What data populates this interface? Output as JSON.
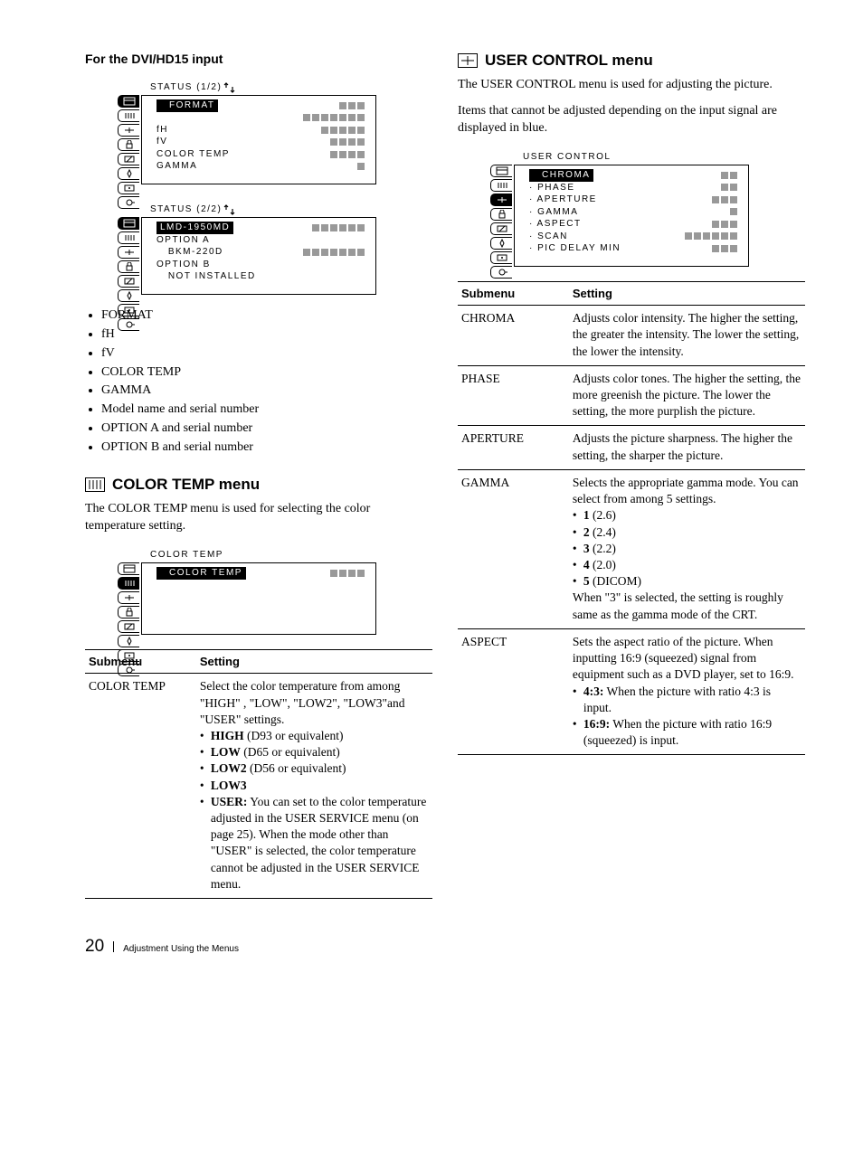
{
  "left": {
    "heading_dvi": "For the DVI/HD15 input",
    "status12_title": "STATUS  (1/2)",
    "status12": {
      "rows": [
        {
          "label": "FORMAT",
          "hilite": true,
          "lead": true,
          "ticks": 3,
          "shifted": false
        },
        {
          "label": "",
          "ticks": 7,
          "shifted": false
        },
        {
          "label": "fH",
          "ticks": 5,
          "shifted": false
        },
        {
          "label": "fV",
          "ticks": 4,
          "shifted": false
        },
        {
          "label": "COLOR TEMP",
          "ticks": 4,
          "shifted": false
        },
        {
          "label": "GAMMA",
          "ticks": 1,
          "shifted": false
        }
      ],
      "selected_tab": 0
    },
    "status22_title": "STATUS  (2/2)",
    "status22": {
      "rows": [
        {
          "label": "LMD-1950MD",
          "hilite": true,
          "ticks": 6,
          "shifted": false
        },
        {
          "label": "OPTION A",
          "ticks": 0,
          "shifted": false
        },
        {
          "label": " BKM-220D",
          "ticks": 7,
          "shifted": true
        },
        {
          "label": "OPTION B",
          "ticks": 0,
          "shifted": false
        },
        {
          "label": " NOT INSTALLED",
          "ticks": 0,
          "shifted": true
        }
      ],
      "selected_tab": 0
    },
    "bullets": [
      "FORMAT",
      "fH",
      "fV",
      "COLOR TEMP",
      "GAMMA",
      "Model name and serial number",
      "OPTION A and serial number",
      "OPTION B and serial number"
    ],
    "color_temp_head": "COLOR TEMP menu",
    "color_temp_intro": "The COLOR TEMP menu is used for selecting the color temperature setting.",
    "colortemp_osd_title": "COLOR TEMP",
    "colortemp_osd": {
      "rows": [
        {
          "label": "COLOR TEMP",
          "hilite": true,
          "lead": true,
          "ticks": 4
        }
      ],
      "selected_tab": 1
    },
    "table_head_sub": "Submenu",
    "table_head_set": "Setting",
    "ct_row_name": "COLOR TEMP",
    "ct_row_intro": "Select the color temperature from among \"HIGH\" , \"LOW\", \"LOW2\", \"LOW3\"and \"USER\" settings.",
    "ct_bul_high_b": "HIGH",
    "ct_bul_high_t": " (D93 or equivalent)",
    "ct_bul_low_b": "LOW",
    "ct_bul_low_t": " (D65 or equivalent)",
    "ct_bul_low2_b": "LOW2",
    "ct_bul_low2_t": " (D56 or equivalent)",
    "ct_bul_low3_b": "LOW3",
    "ct_bul_user_b": "USER:",
    "ct_bul_user_t": " You can set to the color temperature adjusted in the USER SERVICE menu (on page 25).  When the mode other than \"USER\" is selected, the color temperature cannot be adjusted in the USER SERVICE menu."
  },
  "right": {
    "user_control_head": "USER CONTROL menu",
    "intro1": "The USER CONTROL menu is used for adjusting the picture.",
    "intro2": "Items that cannot be adjusted depending on the input signal are displayed in blue.",
    "uc_osd_title": "USER CONTROL",
    "uc_osd": {
      "rows": [
        {
          "label": "CHROMA",
          "hilite": true,
          "lead": true,
          "ticks": 2
        },
        {
          "label": "· PHASE",
          "ticks": 2
        },
        {
          "label": "· APERTURE",
          "ticks": 3
        },
        {
          "label": "· GAMMA",
          "ticks": 1
        },
        {
          "label": "· ASPECT",
          "ticks": 3
        },
        {
          "label": "· SCAN",
          "ticks": 6
        },
        {
          "label": "· PIC DELAY MIN",
          "ticks": 3
        }
      ],
      "selected_tab": 2
    },
    "table_head_sub": "Submenu",
    "table_head_set": "Setting",
    "rows": {
      "chroma_name": "CHROMA",
      "chroma_set": "Adjusts color intensity.  The higher the setting, the greater the intensity.  The lower the setting, the lower the intensity.",
      "phase_name": "PHASE",
      "phase_set": "Adjusts color tones.  The higher the setting, the more greenish the picture.  The lower the setting, the more purplish the picture.",
      "aperture_name": "APERTURE",
      "aperture_set": "Adjusts the picture sharpness. The higher the setting, the sharper the picture.",
      "gamma_name": "GAMMA",
      "gamma_set1": "Selects the appropriate gamma mode.  You can select from among 5 settings.",
      "gamma_b1b": "1",
      "gamma_b1t": " (2.6)",
      "gamma_b2b": "2",
      "gamma_b2t": " (2.4)",
      "gamma_b3b": "3",
      "gamma_b3t": " (2.2)",
      "gamma_b4b": "4",
      "gamma_b4t": " (2.0)",
      "gamma_b5b": "5",
      "gamma_b5t": " (DICOM)",
      "gamma_set2": "When \"3\" is selected, the setting is roughly same as the gamma mode of the CRT.",
      "aspect_name": "ASPECT",
      "aspect_set1": "Sets the aspect ratio of the picture.  When inputting 16:9 (squeezed) signal from equipment such as a DVD player, set to 16:9.",
      "aspect_b1b": "4:3:",
      "aspect_b1t": " When the picture with ratio 4:3 is input.",
      "aspect_b2b": "16:9:",
      "aspect_b2t": " When the picture with ratio 16:9 (squeezed) is input."
    }
  },
  "footer": {
    "page": "20",
    "section": "Adjustment Using the Menus"
  }
}
